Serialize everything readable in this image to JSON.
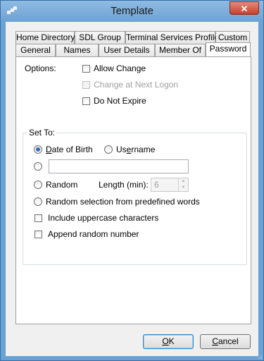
{
  "window": {
    "title": "Template",
    "close_glyph": "✕"
  },
  "tabs_row_back": [
    {
      "label": "Home Directory"
    },
    {
      "label": "SDL Group"
    },
    {
      "label": "Terminal Services Profile"
    },
    {
      "label": "Custom"
    }
  ],
  "tabs_row_front": [
    {
      "label": "General"
    },
    {
      "label": "Names"
    },
    {
      "label": "User Details"
    },
    {
      "label": "Member Of"
    },
    {
      "label": "Password",
      "active": true
    }
  ],
  "options": {
    "label": "Options:",
    "allow_change": {
      "label": "Allow Change",
      "checked": false
    },
    "change_next_logon": {
      "label": "Change at Next Logon",
      "checked": false,
      "enabled": false
    },
    "do_not_expire": {
      "label": "Do Not Expire",
      "checked": false
    }
  },
  "set_to": {
    "label": "Set To:",
    "date_of_birth": {
      "label_first": "D",
      "label_rest": "ate of Birth",
      "checked": true
    },
    "username": {
      "label_first": "Us",
      "label_u": "e",
      "label_rest": "rname",
      "checked": false
    },
    "custom": {
      "value": "",
      "checked": false
    },
    "random": {
      "label": "Random",
      "checked": false
    },
    "length": {
      "label": "Length (min):",
      "value": "6"
    },
    "random_words": {
      "label": "Random selection from predefined words",
      "checked": false
    },
    "include_uppercase": {
      "label": "Include uppercase characters",
      "checked": false
    },
    "append_number": {
      "label": "Append random number",
      "checked": false
    }
  },
  "buttons": {
    "ok_u": "O",
    "ok_rest": "K",
    "cancel_u": "C",
    "cancel_rest": "ancel"
  },
  "icons": {
    "app": "app-icon",
    "close": "close-icon",
    "spin_up": "▲",
    "spin_down": "▼"
  }
}
